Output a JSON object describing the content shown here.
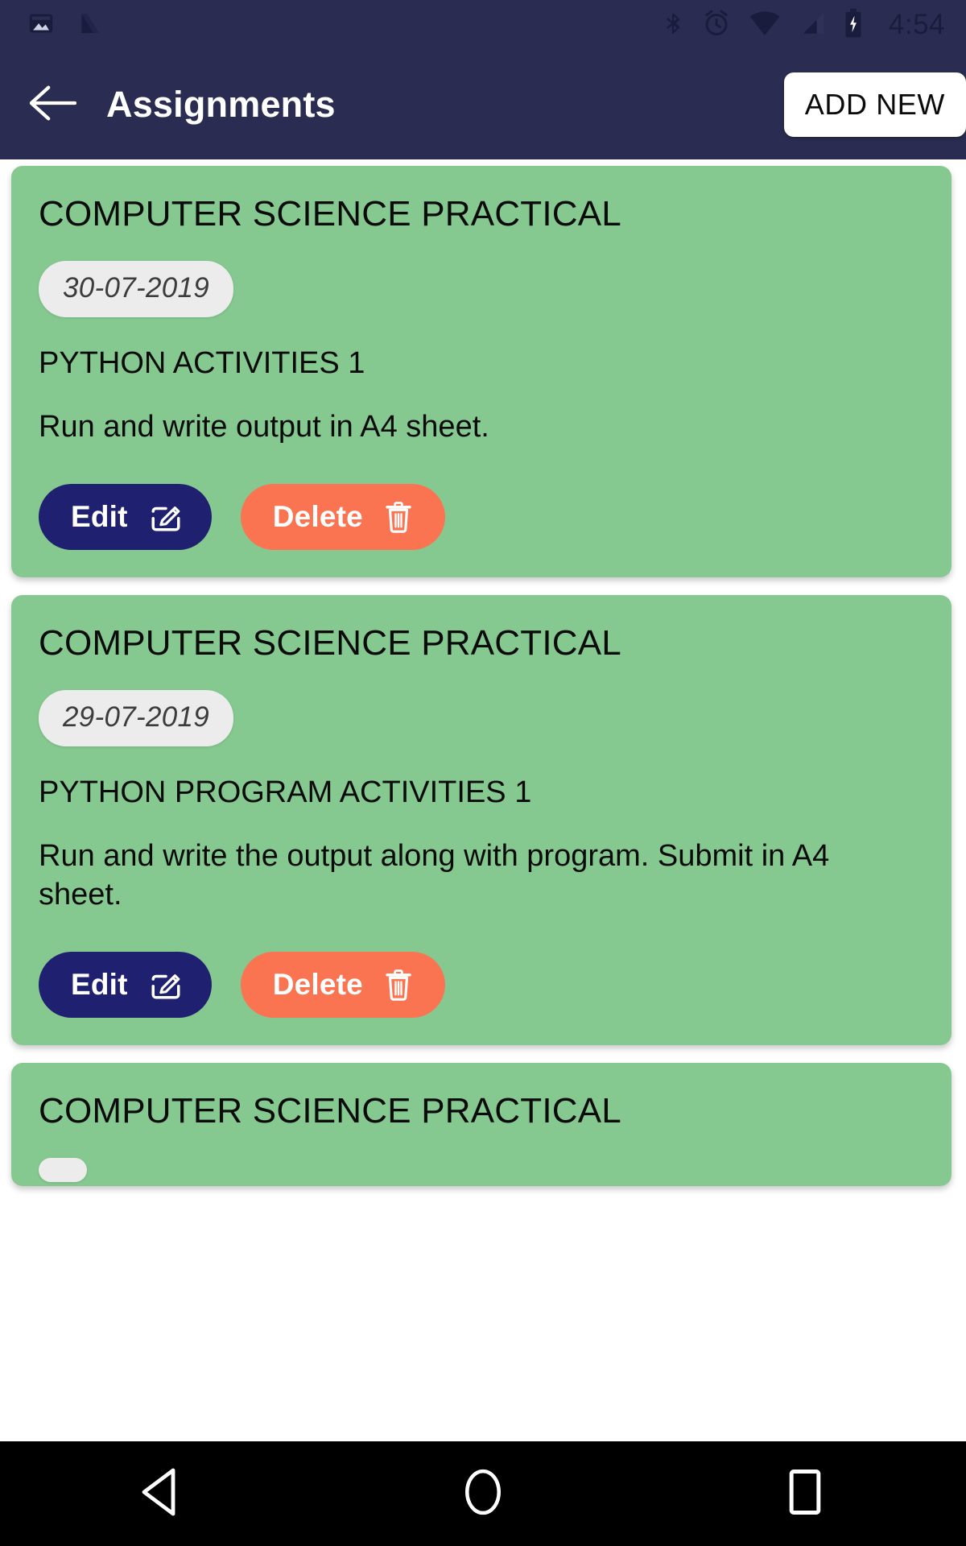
{
  "status_bar": {
    "time": "4:54",
    "left_icons": [
      "photo-icon",
      "nimbus-n-icon"
    ],
    "right_icons": [
      "bluetooth-icon",
      "alarm-icon",
      "wifi-icon",
      "cell-signal-icon",
      "battery-charging-icon"
    ],
    "background_color": "#2a2d51"
  },
  "app_bar": {
    "back_icon": "arrow-left-icon",
    "title": "Assignments",
    "add_new_label": "ADD NEW",
    "background_color": "#2a2d51",
    "title_color": "#ffffff"
  },
  "theme": {
    "card_green": "#85c990",
    "edit_navy": "#1f2170",
    "delete_coral": "#fb7452",
    "chip_gray": "#ececec",
    "page_background": "#ffffff"
  },
  "buttons": {
    "edit_label": "Edit",
    "edit_icon": "edit-pencil-icon",
    "delete_label": "Delete",
    "delete_icon": "trash-icon"
  },
  "assignments": [
    {
      "title": "COMPUTER SCIENCE PRACTICAL",
      "date": "30-07-2019",
      "subtitle": "PYTHON ACTIVITIES 1",
      "description": "Run and write output in A4 sheet."
    },
    {
      "title": "COMPUTER SCIENCE PRACTICAL",
      "date": "29-07-2019",
      "subtitle": "PYTHON PROGRAM ACTIVITIES 1",
      "description": "Run and write the output along with program. Submit in A4 sheet."
    },
    {
      "title": "COMPUTER SCIENCE PRACTICAL",
      "date": "",
      "subtitle": "",
      "description": ""
    }
  ],
  "nav_bar": {
    "back_icon": "nav-back-triangle-icon",
    "home_icon": "nav-home-circle-icon",
    "recents_icon": "nav-recents-square-icon",
    "background_color": "#000000"
  }
}
